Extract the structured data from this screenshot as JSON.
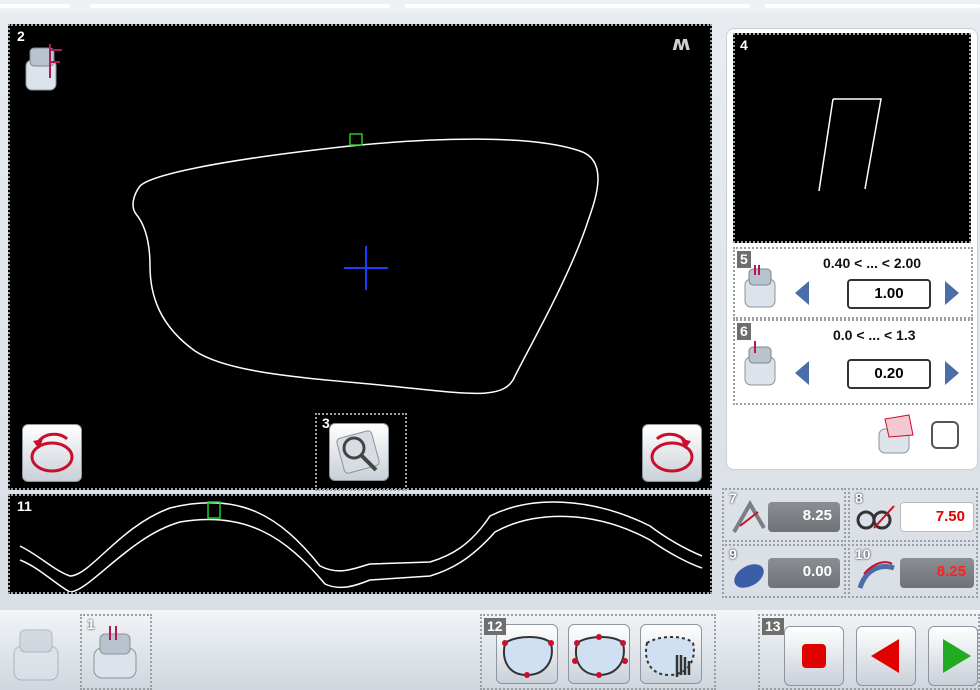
{
  "top_strip": {
    "segments": 5
  },
  "main_view": {
    "number": "2",
    "shape_icon": "ruler-profile-icon",
    "corner_icon": "glasses-symbol-icon",
    "rotate_left_icon": "rotate-left-lens-icon",
    "rotate_right_icon": "rotate-right-lens-icon",
    "tool": {
      "number": "3",
      "icon": "magnifier-tool-icon"
    },
    "colors": {
      "outline": "#ffffff",
      "crosshair": "#1e3cff",
      "marker": "#22cc22"
    }
  },
  "preview": {
    "number": "4"
  },
  "param_5": {
    "number": "5",
    "range": "0.40 < ... < 2.00",
    "value": "1.00"
  },
  "param_6": {
    "number": "6",
    "range": "0.0 < ... < 1.3",
    "value": "0.20"
  },
  "options": {
    "icon": "lens-bevel-icon",
    "checked": false
  },
  "profile": {
    "number": "11"
  },
  "readouts": [
    {
      "number": "7",
      "icon": "bevel-angle-icon",
      "value": "8.25",
      "style": "grey"
    },
    {
      "number": "8",
      "icon": "frame-curve-icon",
      "value": "7.50",
      "style": "white"
    },
    {
      "number": "9",
      "icon": "lens-tilt-icon",
      "value": "0.00",
      "style": "grey"
    },
    {
      "number": "10",
      "icon": "base-curve-icon",
      "value": "8.25",
      "style": "red"
    }
  ],
  "bottom": {
    "home_icon": "machine-home-icon",
    "group1": {
      "number": "1",
      "icon": "edger-profile-icon"
    },
    "group12": {
      "number": "12",
      "icons": [
        "lens-points-bottom-icon",
        "lens-points-sides-icon",
        "lens-hand-edit-icon"
      ]
    },
    "group13": {
      "number": "13",
      "icons": [
        "stop-icon",
        "back-icon",
        "start-icon"
      ]
    },
    "colors": {
      "stop": "#e00000",
      "back": "#e00000",
      "start": "#22aa22"
    }
  }
}
